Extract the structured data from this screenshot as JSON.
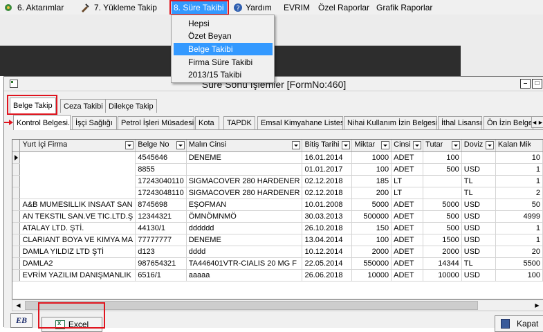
{
  "menubar": {
    "items": [
      {
        "label": "6.  Aktarımlar",
        "icon": "gear-icon"
      },
      {
        "label": "7.  Yükleme Takip",
        "icon": "tools-icon"
      },
      {
        "label": "8. Süre Takibi",
        "icon": ""
      },
      {
        "label": "Yardım",
        "icon": "help-icon"
      },
      {
        "label": "EVRIM",
        "icon": ""
      },
      {
        "label": "Özel Raporlar",
        "icon": ""
      },
      {
        "label": "Grafik Raporlar",
        "icon": ""
      }
    ],
    "active_item": "8. Süre Takibi"
  },
  "dropdown": {
    "items": [
      "Hepsi",
      "Özet Beyan",
      "Belge Takibi",
      "Firma Süre Takibi",
      "2013/15 Takibi"
    ],
    "selected": "Belge Takibi"
  },
  "window": {
    "title": "Süre Sonu İşlemler [FormNo:460]",
    "controls": {
      "minimize": "–",
      "maximize": "□"
    }
  },
  "tabs": {
    "primary": [
      "Belge Takip",
      "Ceza Takibi",
      "Dilekçe Takip"
    ],
    "active_primary": "Belge Takip",
    "secondary": [
      "Kontrol Belgesi.",
      "İşçi Sağlığı",
      "Petrol İşleri Müsadesi",
      "Kota",
      "TAPDK",
      "Emsal Kimyahane Listesi",
      "Nihai Kullanım İzin Belgesi",
      "İthal Lisansı",
      "Ön İzin Belges"
    ],
    "active_secondary": "Kontrol Belgesi.",
    "scroll_arrows": "◄►"
  },
  "grid": {
    "columns": [
      "Yurt İçi Firma",
      "Belge No",
      "Malın Cinsi",
      "Bitiş Tarihi",
      "Miktar",
      "Cinsi",
      "Tutar",
      "Doviz",
      "Kalan Miktar"
    ],
    "rows": [
      {
        "firma": "",
        "belge_no": "4545646",
        "malin_cinsi": "DENEME",
        "bitis": "16.01.2014",
        "miktar": "1000",
        "cinsi": "ADET",
        "tutar": "100",
        "doviz": "",
        "kalan": "10"
      },
      {
        "firma": "",
        "belge_no": "8855",
        "malin_cinsi": "",
        "bitis": "01.01.2017",
        "miktar": "100",
        "cinsi": "ADET",
        "tutar": "500",
        "doviz": "USD",
        "kalan": "1"
      },
      {
        "firma": "",
        "belge_no": "17243040110",
        "malin_cinsi": "SIGMACOVER 280 HARDENER",
        "bitis": "02.12.2018",
        "miktar": "185",
        "cinsi": "LT",
        "tutar": "",
        "doviz": "TL",
        "kalan": "1"
      },
      {
        "firma": "",
        "belge_no": "17243048110",
        "malin_cinsi": "SIGMACOVER 280 HARDENER",
        "bitis": "02.12.2018",
        "miktar": "200",
        "cinsi": "LT",
        "tutar": "",
        "doviz": "TL",
        "kalan": "2"
      },
      {
        "firma": "A&B MUMESILLIK INSAAT SAN",
        "belge_no": "8745698",
        "malin_cinsi": "EŞOFMAN",
        "bitis": "10.01.2008",
        "miktar": "5000",
        "cinsi": "ADET",
        "tutar": "5000",
        "doviz": "USD",
        "kalan": "50"
      },
      {
        "firma": "AN TEKSTIL SAN.VE TIC.LTD.Ş",
        "belge_no": "12344321",
        "malin_cinsi": "ÖMNÖMNMÖ",
        "bitis": "30.03.2013",
        "miktar": "500000",
        "cinsi": "ADET",
        "tutar": "500",
        "doviz": "USD",
        "kalan": "4999"
      },
      {
        "firma": "ATALAY LTD. ŞTİ.",
        "belge_no": "44130/1",
        "malin_cinsi": "dddddd",
        "bitis": "26.10.2018",
        "miktar": "150",
        "cinsi": "ADET",
        "tutar": "500",
        "doviz": "USD",
        "kalan": "1"
      },
      {
        "firma": "CLARIANT BOYA VE KIMYA MA",
        "belge_no": "77777777",
        "malin_cinsi": "DENEME",
        "bitis": "13.04.2014",
        "miktar": "100",
        "cinsi": "ADET",
        "tutar": "1500",
        "doviz": "USD",
        "kalan": "1"
      },
      {
        "firma": "DAMLA YILDIZ LTD ŞTİ",
        "belge_no": "d123",
        "malin_cinsi": "dddd",
        "bitis": "10.12.2014",
        "miktar": "2000",
        "cinsi": "ADET",
        "tutar": "2000",
        "doviz": "USD",
        "kalan": "20"
      },
      {
        "firma": "DAMLA2",
        "belge_no": "987654321",
        "malin_cinsi": "TA446401VTR-CIALIS 20 MG F",
        "bitis": "22.05.2014",
        "miktar": "550000",
        "cinsi": "ADET",
        "tutar": "14344",
        "doviz": "TL",
        "kalan": "5500"
      },
      {
        "firma": "EVRİM YAZILIM DANIŞMANLIK",
        "belge_no": "6516/1",
        "malin_cinsi": "aaaaa",
        "bitis": "26.06.2018",
        "miktar": "10000",
        "cinsi": "ADET",
        "tutar": "10000",
        "doviz": "USD",
        "kalan": "100"
      }
    ]
  },
  "bottom": {
    "logo": "EB",
    "excel_label": "Excel",
    "close_label": "Kapat"
  },
  "colors": {
    "highlight": "#3399ff",
    "annotation_red": "#e0141e"
  }
}
